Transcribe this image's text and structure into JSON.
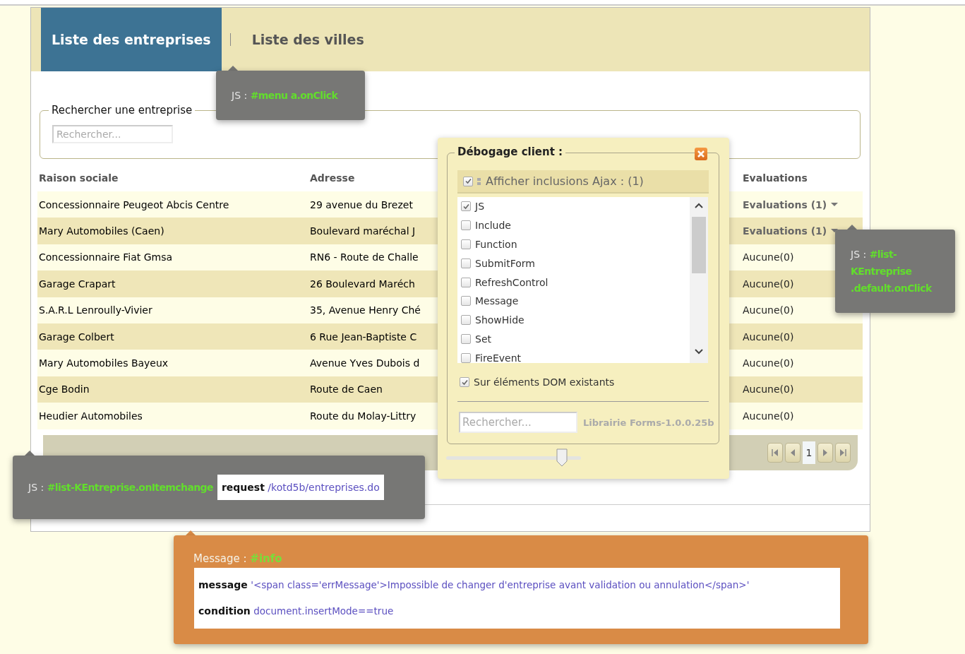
{
  "tabs": [
    {
      "label": "Liste des entreprises",
      "selected": true
    },
    {
      "label": "Liste des villes",
      "selected": false
    }
  ],
  "search": {
    "legend": "Rechercher une entreprise",
    "placeholder": "Rechercher..."
  },
  "table": {
    "columns": [
      "Raison sociale",
      "Adresse",
      "Evaluations"
    ],
    "rows": [
      {
        "name": "Concessionnaire Peugeot Abcis Centre",
        "address": "29 avenue du Brezet",
        "evaluations": "Evaluations (1)",
        "kind": "menu"
      },
      {
        "name": "Mary Automobiles (Caen)",
        "address": "Boulevard maréchal J",
        "evaluations": "Evaluations (1)",
        "kind": "menu"
      },
      {
        "name": "Concessionnaire Fiat Gmsa",
        "address": "RN6 - Route de Challe",
        "evaluations": "Aucune(0)",
        "kind": "plain"
      },
      {
        "name": "Garage Crapart",
        "address": "26 Boulevard Maréch",
        "evaluations": "Aucune(0)",
        "kind": "plain"
      },
      {
        "name": "S.A.R.L Lenroully-Vivier",
        "address": "35, Avenue Henry Ché",
        "evaluations": "Aucune(0)",
        "kind": "plain"
      },
      {
        "name": "Garage Colbert",
        "address": "6 Rue Jean-Baptiste C",
        "evaluations": "Aucune(0)",
        "kind": "plain"
      },
      {
        "name": "Mary Automobiles Bayeux",
        "address": "Avenue Yves Dubois d",
        "evaluations": "Aucune(0)",
        "kind": "plain"
      },
      {
        "name": "Cge Bodin",
        "address": "Route de Caen",
        "evaluations": "Aucune(0)",
        "kind": "plain"
      },
      {
        "name": "Heudier Automobiles",
        "address": "Route du Molay-Littry",
        "evaluations": "Aucune(0)",
        "kind": "plain"
      }
    ]
  },
  "pager": {
    "page": "1"
  },
  "debug_panel": {
    "title": "Débogage client :",
    "ajax": {
      "label": "Afficher inclusions Ajax : (1)",
      "checked": true
    },
    "items": [
      {
        "label": "JS",
        "checked": true
      },
      {
        "label": "Include",
        "checked": false
      },
      {
        "label": "Function",
        "checked": false
      },
      {
        "label": "SubmitForm",
        "checked": false
      },
      {
        "label": "RefreshControl",
        "checked": false
      },
      {
        "label": "Message",
        "checked": false
      },
      {
        "label": "ShowHide",
        "checked": false
      },
      {
        "label": "Set",
        "checked": false
      },
      {
        "label": "FireEvent",
        "checked": false
      }
    ],
    "dom": {
      "label": "Sur éléments DOM existants",
      "checked": true
    },
    "search_placeholder": "Rechercher...",
    "version": "Librairie Forms-1.0.0.25b",
    "slider": {
      "level": 0.86
    }
  },
  "tooltips": [
    {
      "kind": "js",
      "prefix": "JS :",
      "target": "#menu a.onClick"
    },
    {
      "kind": "js",
      "prefix": "JS :",
      "target": "#list-KEntreprise.default.onClick"
    },
    {
      "kind": "request",
      "prefix": "JS :",
      "target": "#list-KEntreprise.onItemchange",
      "key": "request",
      "value": "/kotd5b/entreprises.do"
    }
  ],
  "message": {
    "prefix": "Message :",
    "target": "#info",
    "fields": [
      {
        "key": "message",
        "value": "'<span class='errMessage'>Impossible de changer d'entreprise avant validation ou annulation</span>'"
      },
      {
        "key": "condition",
        "value": "document.insertMode==true"
      }
    ]
  }
}
